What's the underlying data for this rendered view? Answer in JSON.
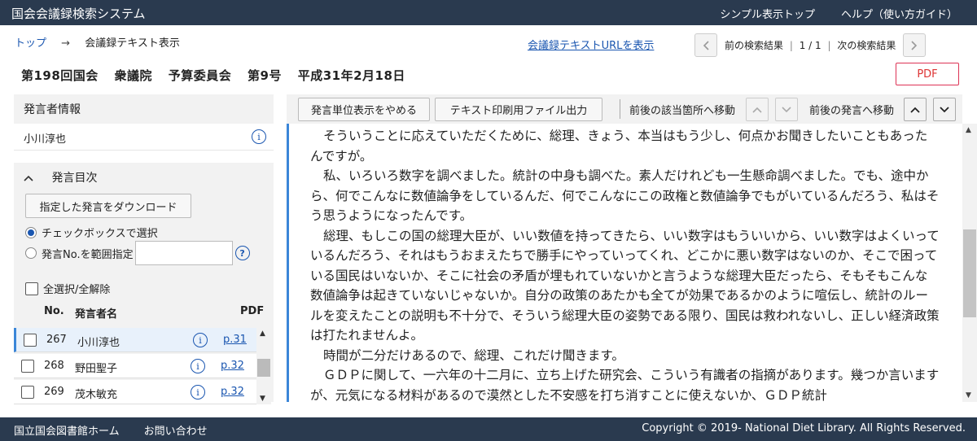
{
  "header": {
    "app_title": "国会会議録検索システム",
    "nav": [
      "シンプル表示トップ",
      "ヘルプ（使い方ガイド）"
    ]
  },
  "breadcrumb": {
    "top": "トップ",
    "arrow": "→",
    "current": "会議録テキスト表示"
  },
  "url_link": "会議録テキストURLを表示",
  "pager": {
    "prev_label": "前の検索結果",
    "position": "1 / 1",
    "next_label": "次の検索結果"
  },
  "meeting": {
    "session": "第198回国会",
    "house": "衆議院",
    "committee": "予算委員会",
    "number": "第9号",
    "date": "平成31年2月18日"
  },
  "pdf_button": "PDF",
  "speaker_info": {
    "heading": "発言者情報",
    "name": "小川淳也"
  },
  "toc": {
    "heading": "発言目次",
    "download_button": "指定した発言をダウンロード",
    "radio_checkbox": "チェックボックスで選択",
    "radio_range": "発言No.を範囲指定",
    "check_all": "全選択/全解除",
    "col_no": "No.",
    "col_speaker": "発言者名",
    "col_pdf": "PDF",
    "rows": [
      {
        "no": "267",
        "name": "小川淳也",
        "page": "p.31"
      },
      {
        "no": "268",
        "name": "野田聖子",
        "page": "p.32"
      },
      {
        "no": "269",
        "name": "茂木敏充",
        "page": "p.32"
      }
    ]
  },
  "toolbar": {
    "unit_toggle": "発言単位表示をやめる",
    "print_output": "テキスト印刷用ファイル出力",
    "nav_hit": "前後の該当箇所へ移動",
    "nav_speech": "前後の発言へ移動"
  },
  "speech_text": [
    "そういうことに応えていただくために、総理、きょう、本当はもう少し、何点かお聞きしたいこともあったんですが。",
    "私、いろいろ数字を調べました。統計の中身も調べた。素人だけれども一生懸命調べました。でも、途中から、何でこんなに数値論争をしているんだ、何でこんなにこの政権と数値論争でもがいているんだろう、私はそう思うようになったんです。",
    "総理、もしこの国の総理大臣が、いい数値を持ってきたら、いい数字はもういいから、いい数字はよくいっているんだろう、それはもうおまえたちで勝手にやっていってくれ、どこかに悪い数字はないのか、そこで困っている国民はいないか、そこに社会の矛盾が埋もれていないかと言うような総理大臣だったら、そもそもこんな数値論争は起きていないじゃないか。自分の政策のあたかも全てが効果であるかのように喧伝し、統計のルールを変えたことの説明も不十分で、そういう総理大臣の姿勢である限り、国民は救われないし、正しい経済政策は打たれませんよ。",
    "時間が二分だけあるので、総理、これだけ聞きます。",
    "ＧＤＰに関して、一六年の十二月に、立ち上げた研究会、こういう有識者の指摘があります。幾つか言いますが、元気になる材料があるので漠然とした不安感を打ち消すことに使えないか、ＧＤＰ統計"
  ],
  "footer": {
    "links": [
      "国立国会図書館ホーム",
      "お問い合わせ"
    ],
    "copyright": "Copyright © 2019- National Diet Library. All Rights Reserved."
  },
  "colors": {
    "header_bg": "#2a3a4f",
    "link": "#1a56b0",
    "accent": "#3b86d8",
    "pdf_red": "#d33333"
  }
}
